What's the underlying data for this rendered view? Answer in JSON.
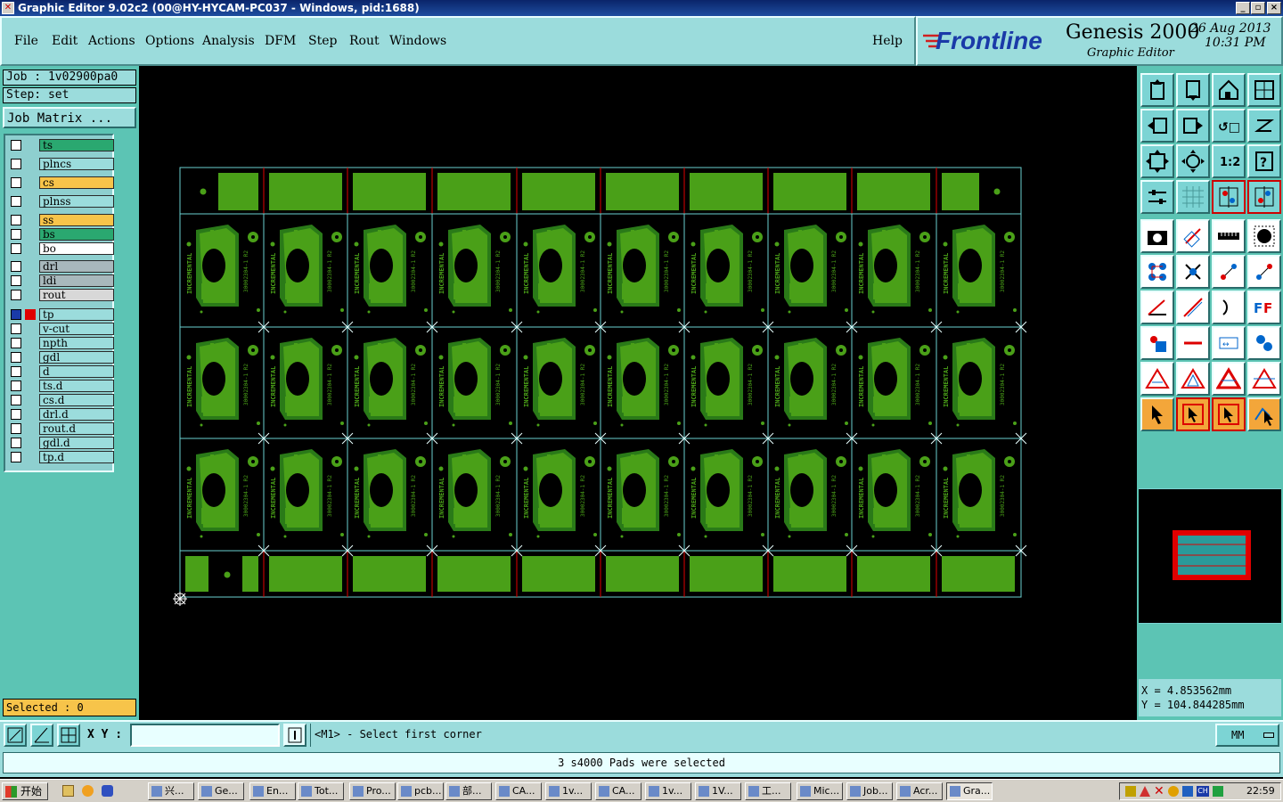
{
  "window": {
    "title": "Graphic Editor 9.02c2 (00@HY-HYCAM-PC037 - Windows, pid:1688)"
  },
  "menu": {
    "items": [
      "File",
      "Edit",
      "Actions",
      "Options",
      "Analysis",
      "DFM",
      "Step",
      "Rout",
      "Windows"
    ],
    "help": "Help"
  },
  "brand": {
    "logo": "Frontline",
    "product": "Genesis 2000",
    "subtitle": "Graphic Editor",
    "date": "26 Aug 2013",
    "time": "10:31 PM"
  },
  "job": {
    "label": "Job : 1v02900pa0",
    "step": "Step: set",
    "matrix_button": "Job Matrix ..."
  },
  "layers": [
    {
      "name": "ts",
      "color": "#2aa870"
    },
    {
      "name": "plncs",
      "color": "#9bdcdc"
    },
    {
      "name": "cs",
      "color": "#f7c44a"
    },
    {
      "name": "plnss",
      "color": "#9bdcdc"
    },
    {
      "name": "ss",
      "color": "#f7c44a"
    },
    {
      "name": "bs",
      "color": "#2aa870"
    },
    {
      "name": "bo",
      "color": "#ffffff"
    },
    {
      "name": "drl",
      "color": "#a8b8bc"
    },
    {
      "name": "ldi",
      "color": "#a8b8bc"
    },
    {
      "name": "rout",
      "color": "#d8d8d8"
    },
    {
      "name": "tp",
      "color": "#9bdcdc"
    },
    {
      "name": "v-cut",
      "color": "#9bdcdc"
    },
    {
      "name": "npth",
      "color": "#9bdcdc"
    },
    {
      "name": "gdl",
      "color": "#9bdcdc"
    },
    {
      "name": "d",
      "color": "#9bdcdc"
    },
    {
      "name": "ts.d",
      "color": "#9bdcdc"
    },
    {
      "name": "cs.d",
      "color": "#9bdcdc"
    },
    {
      "name": "drl.d",
      "color": "#9bdcdc"
    },
    {
      "name": "rout.d",
      "color": "#9bdcdc"
    },
    {
      "name": "gdl.d",
      "color": "#9bdcdc"
    },
    {
      "name": "tp.d",
      "color": "#9bdcdc"
    }
  ],
  "selected": "Selected : 0",
  "board": {
    "pcb_label": "INCREMENTAL",
    "part_label": "30002304-1 R2"
  },
  "coords": {
    "x": "X = 4.853562mm",
    "y": "Y = 104.844285mm"
  },
  "command": {
    "xy_label": "X Y :",
    "xy_value": "",
    "prompt": "<M1> - Select first corner",
    "units": "MM"
  },
  "status": "3 s4000 Pads were selected",
  "taskbar": {
    "start": "开始",
    "tasks": [
      "兴...",
      "Ge...",
      "En...",
      "Tot...",
      "Pro...",
      "pcb...",
      "部...",
      "CA...",
      "1v...",
      "CA...",
      "1v...",
      "1V...",
      "工...",
      "Mic...",
      "Job...",
      "Acr...",
      "Gra..."
    ],
    "clock": "22:59"
  },
  "colors": {
    "copper": "#4aa018",
    "panel_teal": "#9bdcdc",
    "outline": "#6ad0d0",
    "vcut": "#e00000"
  }
}
